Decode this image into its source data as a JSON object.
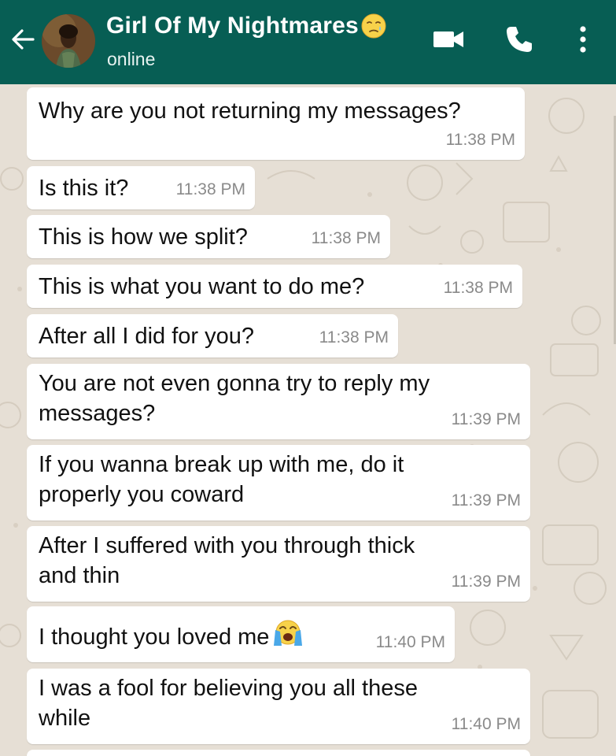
{
  "header": {
    "contact_name": "Girl Of My Nightmares",
    "status": "online",
    "background_color": "#075e54",
    "icons": [
      "back-arrow-icon",
      "video-call-icon",
      "phone-icon",
      "more-vert-icon",
      "sad-face-emoji"
    ]
  },
  "messages": [
    {
      "text": "Why are you not returning my messages?",
      "time": "11:38 PM"
    },
    {
      "text": "Is this it?",
      "time": "11:38 PM"
    },
    {
      "text": "This is how we split?",
      "time": "11:38 PM"
    },
    {
      "text": "This is what you want to do me?",
      "time": "11:38 PM"
    },
    {
      "text": "After all I did for you?",
      "time": "11:38 PM"
    },
    {
      "text_line1": "You are not even gonna try to reply my",
      "text_line2": "messages?",
      "time": "11:39 PM"
    },
    {
      "text_line1": "If you wanna break up with me, do it",
      "text_line2": "properly you coward",
      "time": "11:39 PM"
    },
    {
      "text_line1": "After I suffered with you through thick",
      "text_line2": "and thin",
      "time": "11:39 PM"
    },
    {
      "text": "I thought you loved me",
      "time": "11:40 PM",
      "emoji": "crying-face-emoji"
    },
    {
      "text_line1": "I was a fool for believing you all these",
      "text_line2": "while",
      "time": "11:40 PM"
    }
  ]
}
